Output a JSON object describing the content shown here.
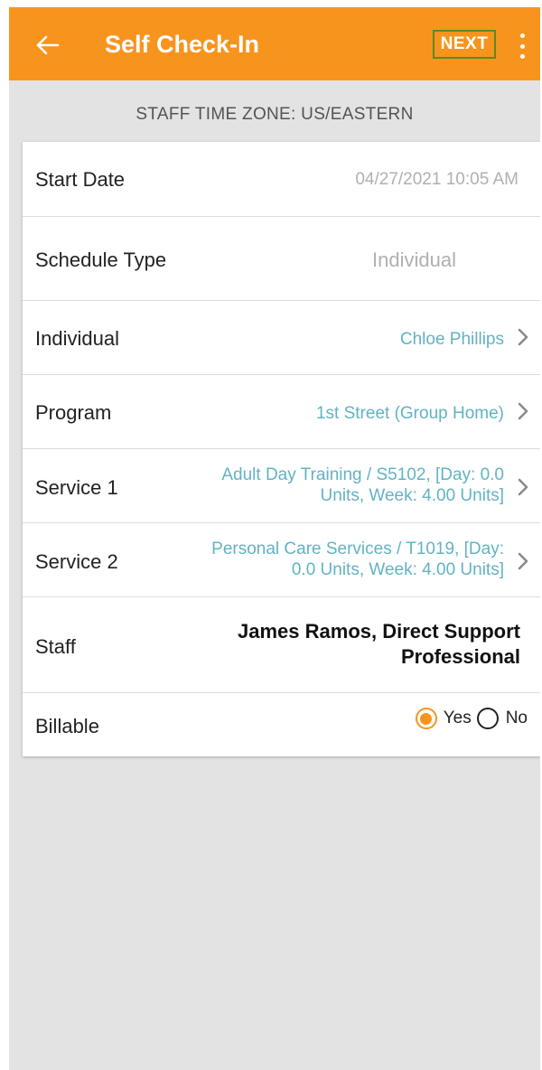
{
  "appbar": {
    "title": "Self Check-In",
    "next_label": "NEXT",
    "accent_color": "#f7941d",
    "back_icon": "arrow-left-icon",
    "menu_icon": "more-vert-icon"
  },
  "timezone_text": "STAFF TIME ZONE: US/EASTERN",
  "fields": {
    "start_date": {
      "label": "Start Date",
      "value": "04/27/2021 10:05 AM"
    },
    "schedule_type": {
      "label": "Schedule Type",
      "value": "Individual"
    },
    "individual": {
      "label": "Individual",
      "value": "Chloe Phillips"
    },
    "program": {
      "label": "Program",
      "value": "1st Street (Group Home)"
    },
    "service1": {
      "label": "Service 1",
      "value_line1": "Adult Day Training / S5102,  [Day: 0.0",
      "value_line2": "Units, Week: 4.00 Units]"
    },
    "service2": {
      "label": "Service 2",
      "value_line1": "Personal Care Services / T1019,  [Day:",
      "value_line2": "0.0 Units, Week: 4.00 Units]"
    },
    "staff": {
      "label": "Staff",
      "value_line1": "James Ramos, Direct Support",
      "value_line2": "Professional"
    },
    "billable": {
      "label": "Billable",
      "yes_label": "Yes",
      "no_label": "No",
      "selected": "Yes"
    }
  }
}
